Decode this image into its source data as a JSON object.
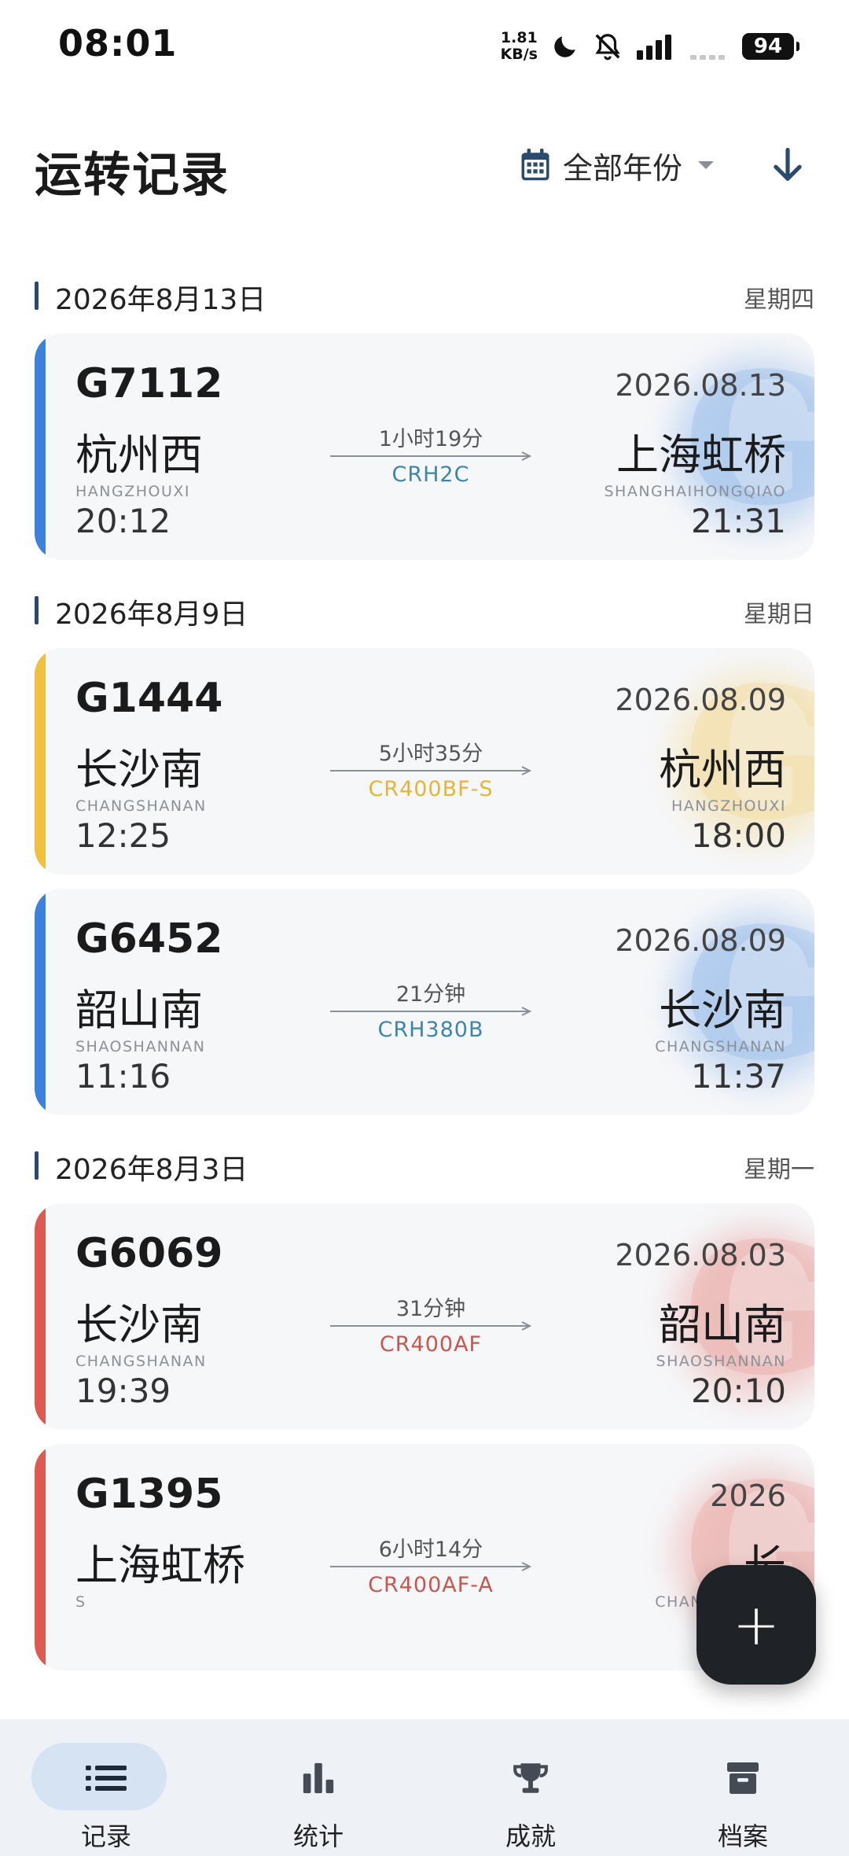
{
  "status_bar": {
    "time": "08:01",
    "net_speed_value": "1.81",
    "net_speed_unit": "KB/s",
    "battery": "94",
    "icons": [
      "moon-icon",
      "bell-off-icon",
      "signal-icon",
      "wifi-dots-icon",
      "battery-icon"
    ]
  },
  "header": {
    "title": "运转记录",
    "year_filter": "全部年份",
    "icons": [
      "calendar-icon",
      "chevron-down-icon",
      "download-icon"
    ]
  },
  "groups": [
    {
      "date": "2026年8月13日",
      "weekday": "星期四",
      "trips": [
        {
          "train": "G7112",
          "date": "2026.08.13",
          "from": "杭州西",
          "from_pinyin": "HANGZHOUXI",
          "dep_time": "20:12",
          "to": "上海虹桥",
          "to_pinyin": "SHANGHAIHONGQIAO",
          "arr_time": "21:31",
          "duration": "1小时19分",
          "model": "CRH2C",
          "accent": "#3c82dc",
          "model_color": "#3e86a8"
        }
      ]
    },
    {
      "date": "2026年8月9日",
      "weekday": "星期日",
      "trips": [
        {
          "train": "G1444",
          "date": "2026.08.09",
          "from": "长沙南",
          "from_pinyin": "CHANGSHANAN",
          "dep_time": "12:25",
          "to": "杭州西",
          "to_pinyin": "HANGZHOUXI",
          "arr_time": "18:00",
          "duration": "5小时35分",
          "model": "CR400BF-S",
          "accent": "#f0c040",
          "model_color": "#e5b43a"
        },
        {
          "train": "G6452",
          "date": "2026.08.09",
          "from": "韶山南",
          "from_pinyin": "SHAOSHANNAN",
          "dep_time": "11:16",
          "to": "长沙南",
          "to_pinyin": "CHANGSHANAN",
          "arr_time": "11:37",
          "duration": "21分钟",
          "model": "CRH380B",
          "accent": "#3c82dc",
          "model_color": "#3e86a8"
        }
      ]
    },
    {
      "date": "2026年8月3日",
      "weekday": "星期一",
      "trips": [
        {
          "train": "G6069",
          "date": "2026.08.03",
          "from": "长沙南",
          "from_pinyin": "CHANGSHANAN",
          "dep_time": "19:39",
          "to": "韶山南",
          "to_pinyin": "SHAOSHANNAN",
          "arr_time": "20:10",
          "duration": "31分钟",
          "model": "CR400AF",
          "accent": "#dd5a50",
          "model_color": "#c9564e"
        },
        {
          "train": "G1395",
          "date": "2026",
          "from": "上海虹桥",
          "from_pinyin": "S",
          "dep_time": "",
          "to": "长",
          "to_pinyin": "CHANGSHANAN",
          "arr_time": "",
          "duration": "6小时14分",
          "model": "CR400AF-A",
          "accent": "#dd5a50",
          "model_color": "#c9564e"
        }
      ]
    }
  ],
  "fab": {
    "symbol": "+",
    "icon": "plus-icon"
  },
  "bottom_nav": [
    {
      "label": "记录",
      "icon": "list-icon",
      "active": true
    },
    {
      "label": "统计",
      "icon": "bar-chart-icon",
      "active": false
    },
    {
      "label": "成就",
      "icon": "trophy-icon",
      "active": false
    },
    {
      "label": "档案",
      "icon": "archive-icon",
      "active": false
    }
  ],
  "colors": {
    "primary": "#2c4a6e",
    "blue": "#3c82dc",
    "yellow": "#f0c040",
    "red": "#dd5a50",
    "nav_bg": "#eef1f5",
    "nav_active": "#d6e3f3"
  }
}
